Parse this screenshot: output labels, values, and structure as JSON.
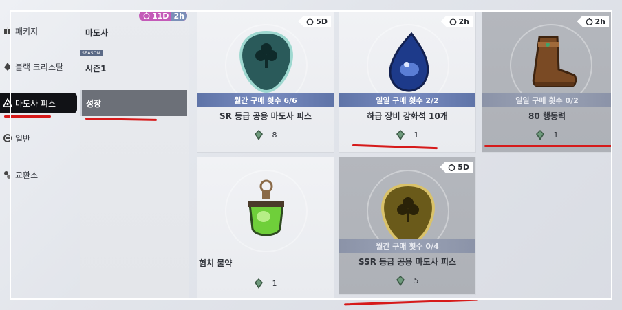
{
  "categories": [
    {
      "label": "패키지",
      "icon": "package-icon",
      "active": false
    },
    {
      "label": "블랙 크리스탈",
      "icon": "crystal-icon",
      "active": false
    },
    {
      "label": "마도사 피스",
      "icon": "piece-icon",
      "active": true
    },
    {
      "label": "일반",
      "icon": "general-icon",
      "active": false
    },
    {
      "label": "교환소",
      "icon": "exchange-icon",
      "active": false
    }
  ],
  "subcategories": [
    {
      "label": "마도사"
    },
    {
      "label": "시즌1",
      "badge": "SEASON"
    },
    {
      "label": "성장",
      "active": true
    }
  ],
  "event_timer": {
    "days": "11D",
    "hours": "2h"
  },
  "cards": [
    {
      "timer": "5D",
      "limit": "월간 구매 횟수 6/6",
      "name": "SR 등급 공용 마도사 피스",
      "price": "8",
      "art": "sr-clover-piece-icon",
      "dim": false
    },
    {
      "timer": "2h",
      "limit": "일일 구매 횟수 2/2",
      "name": "하급 장비 강화석 10개",
      "price": "1",
      "art": "blue-stone-icon",
      "dim": false
    },
    {
      "timer": "2h",
      "limit": "일일 구매 횟수 0/2",
      "name": "80 행동력",
      "price": "1",
      "art": "boot-icon",
      "dim": true
    },
    {
      "timer": "",
      "limit": "",
      "name": "험치 물약",
      "price": "1",
      "art": "potion-icon",
      "dim": false
    },
    {
      "timer": "5D",
      "limit": "월간 구매 횟수 0/4",
      "name": "SSR 등급 공용 마도사 피스",
      "price": "5",
      "art": "ssr-clover-piece-icon",
      "dim": true
    }
  ],
  "colors": {
    "accent": "#5f74a8",
    "active_tab": "#111216",
    "annotation": "#d61a1a",
    "timer_pill": "#c45ab8"
  }
}
